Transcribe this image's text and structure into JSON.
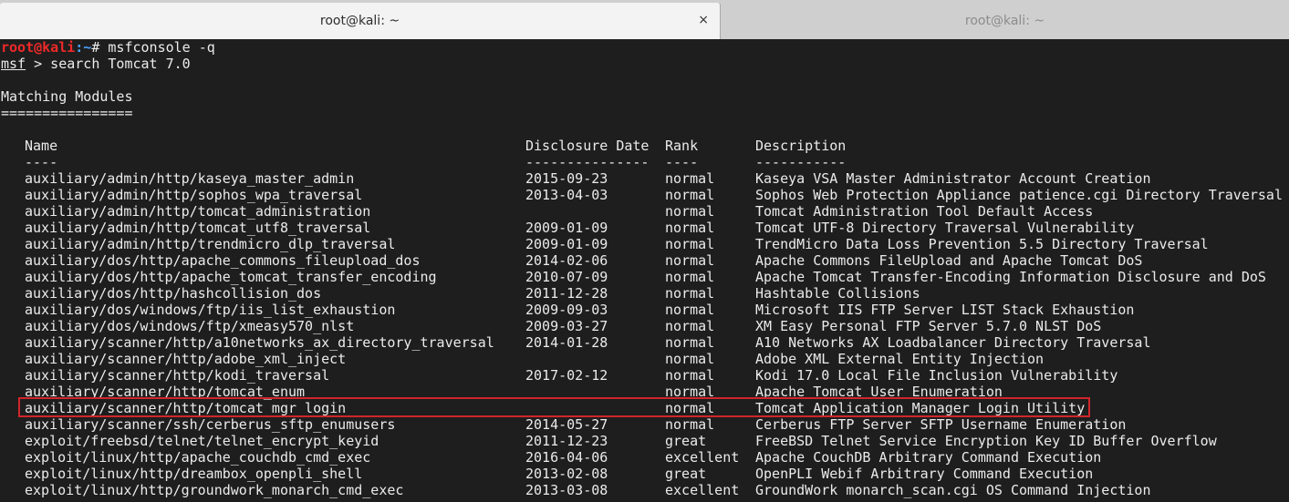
{
  "tabs": [
    {
      "title": "root@kali: ~",
      "active": true
    },
    {
      "title": "root@kali: ~",
      "active": false
    }
  ],
  "close_glyph": "×",
  "prompt": {
    "user": "root@kali",
    "path": ":~",
    "symbol": "# ",
    "command": "msfconsole -q"
  },
  "msf_prompt": {
    "name": "msf",
    "rest": " > search Tomcat 7.0"
  },
  "heading": "Matching Modules",
  "heading_rule": "================",
  "columns": {
    "name": "Name",
    "date": "Disclosure Date",
    "rank": "Rank",
    "description": "Description",
    "name_rule": "----",
    "date_rule": "---------------",
    "rank_rule": "----",
    "description_rule": "-----------"
  },
  "modules": [
    {
      "name": "auxiliary/admin/http/kaseya_master_admin",
      "date": "2015-09-23",
      "rank": "normal",
      "description": "Kaseya VSA Master Administrator Account Creation"
    },
    {
      "name": "auxiliary/admin/http/sophos_wpa_traversal",
      "date": "2013-04-03",
      "rank": "normal",
      "description": "Sophos Web Protection Appliance patience.cgi Directory Traversal"
    },
    {
      "name": "auxiliary/admin/http/tomcat_administration",
      "date": "",
      "rank": "normal",
      "description": "Tomcat Administration Tool Default Access"
    },
    {
      "name": "auxiliary/admin/http/tomcat_utf8_traversal",
      "date": "2009-01-09",
      "rank": "normal",
      "description": "Tomcat UTF-8 Directory Traversal Vulnerability"
    },
    {
      "name": "auxiliary/admin/http/trendmicro_dlp_traversal",
      "date": "2009-01-09",
      "rank": "normal",
      "description": "TrendMicro Data Loss Prevention 5.5 Directory Traversal"
    },
    {
      "name": "auxiliary/dos/http/apache_commons_fileupload_dos",
      "date": "2014-02-06",
      "rank": "normal",
      "description": "Apache Commons FileUpload and Apache Tomcat DoS"
    },
    {
      "name": "auxiliary/dos/http/apache_tomcat_transfer_encoding",
      "date": "2010-07-09",
      "rank": "normal",
      "description": "Apache Tomcat Transfer-Encoding Information Disclosure and DoS"
    },
    {
      "name": "auxiliary/dos/http/hashcollision_dos",
      "date": "2011-12-28",
      "rank": "normal",
      "description": "Hashtable Collisions"
    },
    {
      "name": "auxiliary/dos/windows/ftp/iis_list_exhaustion",
      "date": "2009-09-03",
      "rank": "normal",
      "description": "Microsoft IIS FTP Server LIST Stack Exhaustion"
    },
    {
      "name": "auxiliary/dos/windows/ftp/xmeasy570_nlst",
      "date": "2009-03-27",
      "rank": "normal",
      "description": "XM Easy Personal FTP Server 5.7.0 NLST DoS"
    },
    {
      "name": "auxiliary/scanner/http/a10networks_ax_directory_traversal",
      "date": "2014-01-28",
      "rank": "normal",
      "description": "A10 Networks AX Loadbalancer Directory Traversal"
    },
    {
      "name": "auxiliary/scanner/http/adobe_xml_inject",
      "date": "",
      "rank": "normal",
      "description": "Adobe XML External Entity Injection"
    },
    {
      "name": "auxiliary/scanner/http/kodi_traversal",
      "date": "2017-02-12",
      "rank": "normal",
      "description": "Kodi 17.0 Local File Inclusion Vulnerability"
    },
    {
      "name": "auxiliary/scanner/http/tomcat_enum",
      "date": "",
      "rank": "normal",
      "description": "Apache Tomcat User Enumeration"
    },
    {
      "name": "auxiliary/scanner/http/tomcat_mgr_login",
      "date": "",
      "rank": "normal",
      "description": "Tomcat Application Manager Login Utility",
      "highlighted": true
    },
    {
      "name": "auxiliary/scanner/ssh/cerberus_sftp_enumusers",
      "date": "2014-05-27",
      "rank": "normal",
      "description": "Cerberus FTP Server SFTP Username Enumeration"
    },
    {
      "name": "exploit/freebsd/telnet/telnet_encrypt_keyid",
      "date": "2011-12-23",
      "rank": "great",
      "description": "FreeBSD Telnet Service Encryption Key ID Buffer Overflow"
    },
    {
      "name": "exploit/linux/http/apache_couchdb_cmd_exec",
      "date": "2016-04-06",
      "rank": "excellent",
      "description": "Apache CouchDB Arbitrary Command Execution"
    },
    {
      "name": "exploit/linux/http/dreambox_openpli_shell",
      "date": "2013-02-08",
      "rank": "great",
      "description": "OpenPLI Webif Arbitrary Command Execution"
    },
    {
      "name": "exploit/linux/http/groundwork_monarch_cmd_exec",
      "date": "2013-03-08",
      "rank": "excellent",
      "description": "GroundWork monarch_scan.cgi OS Command Injection"
    }
  ],
  "highlight_color": "#d0262b"
}
